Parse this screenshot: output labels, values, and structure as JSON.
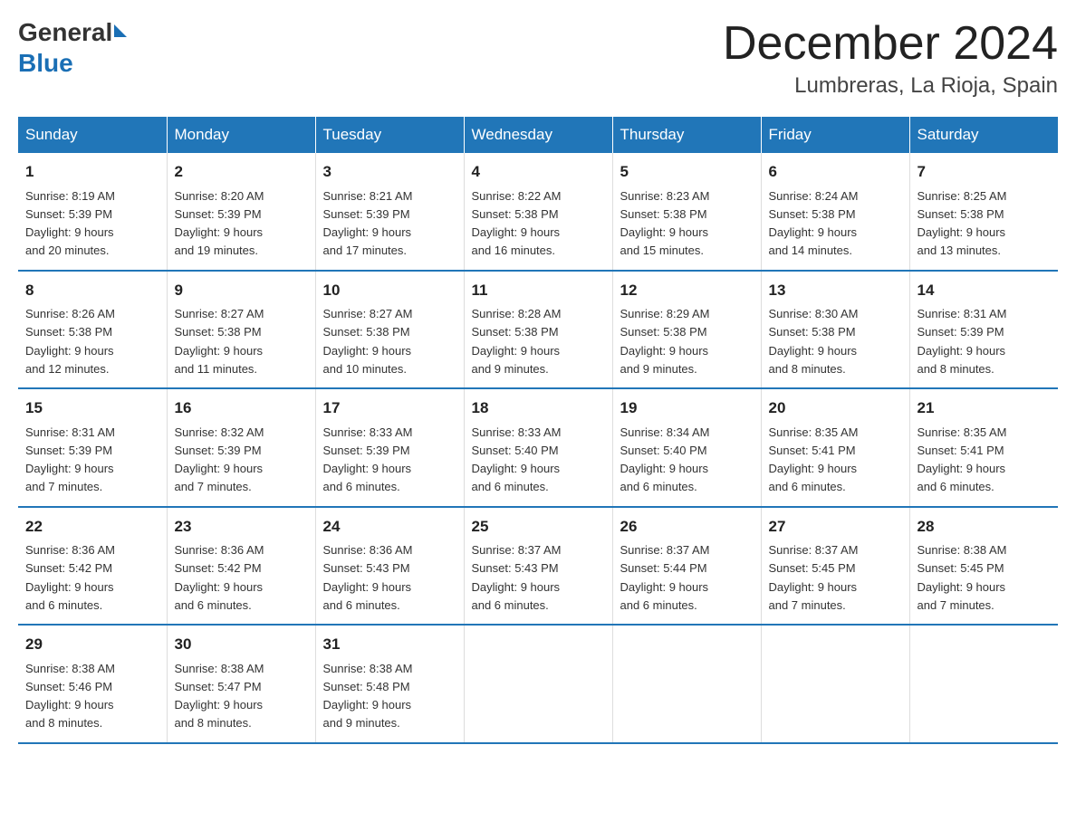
{
  "header": {
    "logo_general": "General",
    "logo_blue": "Blue",
    "month_title": "December 2024",
    "location": "Lumbreras, La Rioja, Spain"
  },
  "weekdays": [
    "Sunday",
    "Monday",
    "Tuesday",
    "Wednesday",
    "Thursday",
    "Friday",
    "Saturday"
  ],
  "weeks": [
    [
      {
        "day": "1",
        "sunrise": "8:19 AM",
        "sunset": "5:39 PM",
        "daylight": "9 hours and 20 minutes."
      },
      {
        "day": "2",
        "sunrise": "8:20 AM",
        "sunset": "5:39 PM",
        "daylight": "9 hours and 19 minutes."
      },
      {
        "day": "3",
        "sunrise": "8:21 AM",
        "sunset": "5:39 PM",
        "daylight": "9 hours and 17 minutes."
      },
      {
        "day": "4",
        "sunrise": "8:22 AM",
        "sunset": "5:38 PM",
        "daylight": "9 hours and 16 minutes."
      },
      {
        "day": "5",
        "sunrise": "8:23 AM",
        "sunset": "5:38 PM",
        "daylight": "9 hours and 15 minutes."
      },
      {
        "day": "6",
        "sunrise": "8:24 AM",
        "sunset": "5:38 PM",
        "daylight": "9 hours and 14 minutes."
      },
      {
        "day": "7",
        "sunrise": "8:25 AM",
        "sunset": "5:38 PM",
        "daylight": "9 hours and 13 minutes."
      }
    ],
    [
      {
        "day": "8",
        "sunrise": "8:26 AM",
        "sunset": "5:38 PM",
        "daylight": "9 hours and 12 minutes."
      },
      {
        "day": "9",
        "sunrise": "8:27 AM",
        "sunset": "5:38 PM",
        "daylight": "9 hours and 11 minutes."
      },
      {
        "day": "10",
        "sunrise": "8:27 AM",
        "sunset": "5:38 PM",
        "daylight": "9 hours and 10 minutes."
      },
      {
        "day": "11",
        "sunrise": "8:28 AM",
        "sunset": "5:38 PM",
        "daylight": "9 hours and 9 minutes."
      },
      {
        "day": "12",
        "sunrise": "8:29 AM",
        "sunset": "5:38 PM",
        "daylight": "9 hours and 9 minutes."
      },
      {
        "day": "13",
        "sunrise": "8:30 AM",
        "sunset": "5:38 PM",
        "daylight": "9 hours and 8 minutes."
      },
      {
        "day": "14",
        "sunrise": "8:31 AM",
        "sunset": "5:39 PM",
        "daylight": "9 hours and 8 minutes."
      }
    ],
    [
      {
        "day": "15",
        "sunrise": "8:31 AM",
        "sunset": "5:39 PM",
        "daylight": "9 hours and 7 minutes."
      },
      {
        "day": "16",
        "sunrise": "8:32 AM",
        "sunset": "5:39 PM",
        "daylight": "9 hours and 7 minutes."
      },
      {
        "day": "17",
        "sunrise": "8:33 AM",
        "sunset": "5:39 PM",
        "daylight": "9 hours and 6 minutes."
      },
      {
        "day": "18",
        "sunrise": "8:33 AM",
        "sunset": "5:40 PM",
        "daylight": "9 hours and 6 minutes."
      },
      {
        "day": "19",
        "sunrise": "8:34 AM",
        "sunset": "5:40 PM",
        "daylight": "9 hours and 6 minutes."
      },
      {
        "day": "20",
        "sunrise": "8:35 AM",
        "sunset": "5:41 PM",
        "daylight": "9 hours and 6 minutes."
      },
      {
        "day": "21",
        "sunrise": "8:35 AM",
        "sunset": "5:41 PM",
        "daylight": "9 hours and 6 minutes."
      }
    ],
    [
      {
        "day": "22",
        "sunrise": "8:36 AM",
        "sunset": "5:42 PM",
        "daylight": "9 hours and 6 minutes."
      },
      {
        "day": "23",
        "sunrise": "8:36 AM",
        "sunset": "5:42 PM",
        "daylight": "9 hours and 6 minutes."
      },
      {
        "day": "24",
        "sunrise": "8:36 AM",
        "sunset": "5:43 PM",
        "daylight": "9 hours and 6 minutes."
      },
      {
        "day": "25",
        "sunrise": "8:37 AM",
        "sunset": "5:43 PM",
        "daylight": "9 hours and 6 minutes."
      },
      {
        "day": "26",
        "sunrise": "8:37 AM",
        "sunset": "5:44 PM",
        "daylight": "9 hours and 6 minutes."
      },
      {
        "day": "27",
        "sunrise": "8:37 AM",
        "sunset": "5:45 PM",
        "daylight": "9 hours and 7 minutes."
      },
      {
        "day": "28",
        "sunrise": "8:38 AM",
        "sunset": "5:45 PM",
        "daylight": "9 hours and 7 minutes."
      }
    ],
    [
      {
        "day": "29",
        "sunrise": "8:38 AM",
        "sunset": "5:46 PM",
        "daylight": "9 hours and 8 minutes."
      },
      {
        "day": "30",
        "sunrise": "8:38 AM",
        "sunset": "5:47 PM",
        "daylight": "9 hours and 8 minutes."
      },
      {
        "day": "31",
        "sunrise": "8:38 AM",
        "sunset": "5:48 PM",
        "daylight": "9 hours and 9 minutes."
      },
      null,
      null,
      null,
      null
    ]
  ],
  "labels": {
    "sunrise": "Sunrise:",
    "sunset": "Sunset:",
    "daylight": "Daylight:"
  }
}
